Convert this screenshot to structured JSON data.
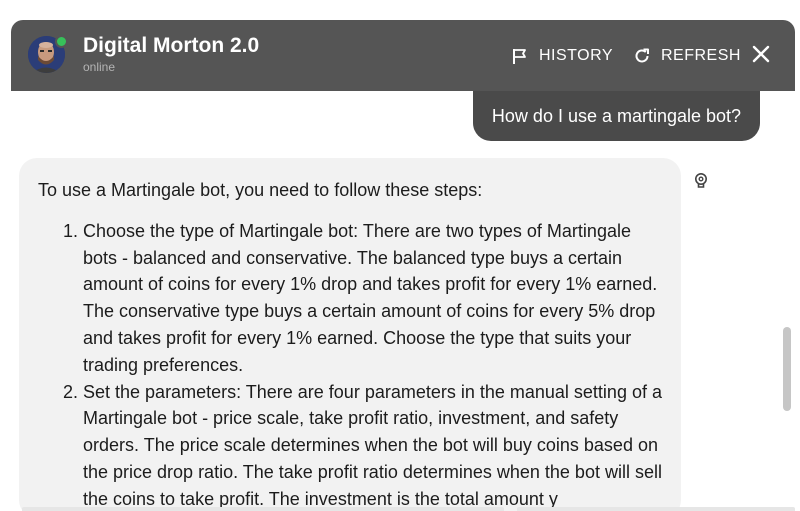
{
  "header": {
    "title": "Digital Morton 2.0",
    "status": "online",
    "history_label": "HISTORY",
    "refresh_label": "REFRESH",
    "icons": {
      "history": "flag-icon",
      "refresh": "refresh-icon",
      "close": "close-icon"
    },
    "colors": {
      "background": "#555555",
      "status_dot": "#37c15a"
    }
  },
  "chat": {
    "user_message": "How do I use a martingale bot?",
    "bot_intro": "To use a Martingale bot, you need to follow these steps:",
    "bot_steps": [
      "Choose the type of Martingale bot: There are two types of Martingale bots - balanced and conservative. The balanced type buys a certain amount of coins for every 1% drop and takes profit for every 1% earned. The conservative type buys a certain amount of coins for every 5% drop and takes profit for every 1% earned. Choose the type that suits your trading preferences.",
      "Set the parameters: There are four parameters in the manual setting of a Martingale bot - price scale, take profit ratio, investment, and safety orders. The price scale determines when the bot will buy coins based on the price drop ratio. The take profit ratio determines when the bot will sell the coins to take profit. The investment is the total amount y"
    ],
    "feedback_icon": "lightbulb-icon",
    "colors": {
      "user_bubble": "#4a4a4a",
      "bot_bubble": "#f2f2f2"
    }
  }
}
